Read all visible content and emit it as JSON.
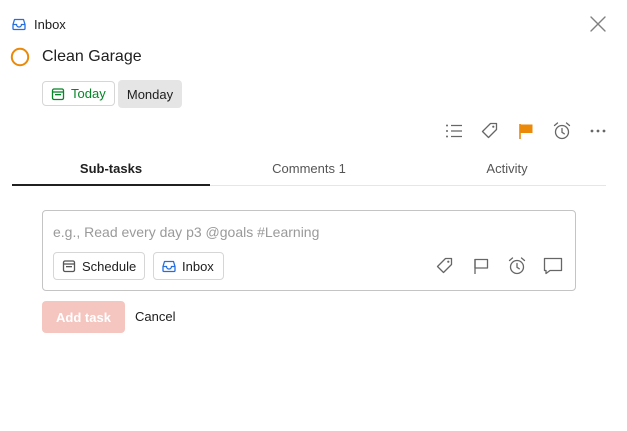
{
  "header": {
    "project_label": "Inbox",
    "icons": {
      "project": "inbox-icon",
      "close": "close-icon"
    }
  },
  "task": {
    "title": "Clean Garage",
    "priority_color": "#eb8909",
    "date_chips": [
      {
        "label": "Today",
        "icon": "calendar-icon",
        "color": "#058527"
      },
      {
        "label": "Monday"
      }
    ],
    "actions": [
      "subtasks-list-icon",
      "tag-icon",
      "flag-icon",
      "alarm-icon",
      "more-icon"
    ]
  },
  "tabs": [
    {
      "label": "Sub-tasks",
      "active": true
    },
    {
      "label": "Comments 1",
      "active": false
    },
    {
      "label": "Activity",
      "active": false
    }
  ],
  "composer": {
    "placeholder": "e.g., Read every day p3 @goals #Learning",
    "value": "",
    "schedule_label": "Schedule",
    "project_label": "Inbox",
    "tool_icons": [
      "tag-icon",
      "flag-icon",
      "alarm-icon",
      "comment-icon"
    ]
  },
  "buttons": {
    "add_task": "Add task",
    "cancel": "Cancel"
  },
  "colors": {
    "accent_green": "#058527",
    "priority_orange": "#eb8909",
    "inbox_blue": "#246fe0",
    "add_disabled": "#f5c5c0"
  }
}
